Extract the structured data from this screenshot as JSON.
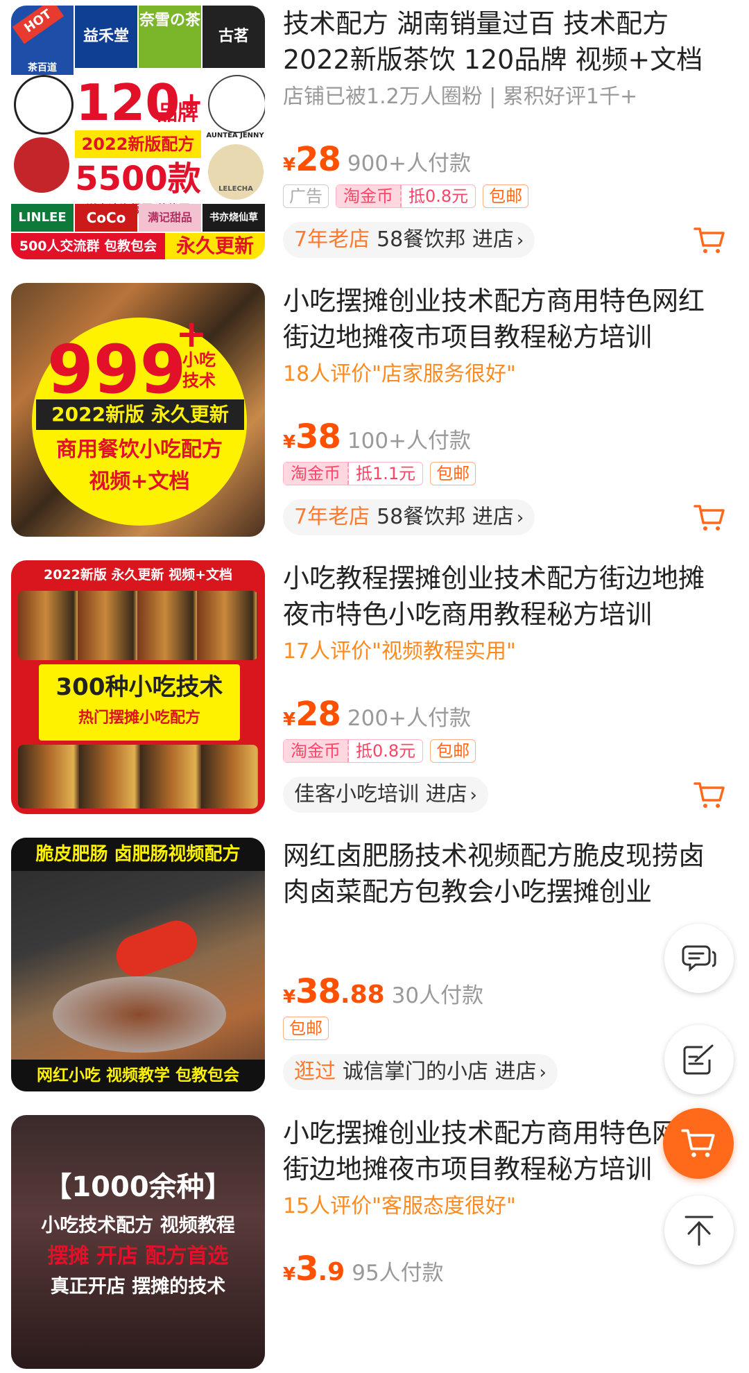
{
  "items": [
    {
      "title": "技术配方 湖南销量过百 技术配方 2022新版茶饮 120品牌 视频+文档 专",
      "subtitle": "店铺已被1.2万人圈粉 | 累积好评1千+",
      "subtitle_style": "gray",
      "currency": "¥",
      "price": "28",
      "price_decimal": "",
      "paid": "900+人付款",
      "ad_tag": "广告",
      "coin_label": "淘金币",
      "coin_value": "抵0.8元",
      "ship_tag": "包邮",
      "shop_badge": "7年老店",
      "shop_name": "58餐饮邦",
      "shop_enter": "进店",
      "thumb": {
        "hot": "HOT",
        "big": "120",
        "plus": "+",
        "brand_word": "品牌",
        "year_line": "2022新版配方",
        "count": "5500款",
        "bonus": "送高清海报图 装修图",
        "footer_left": "500人交流群 包教包会",
        "footer_right": "永久更新",
        "brands": [
          "益禾堂",
          "奈雪の茶",
          "古茗",
          "茶百道",
          "LINLEE",
          "CoCo",
          "满记甜品",
          "书亦烧仙草",
          "AUNTEA JENNY",
          "LELECHA"
        ]
      }
    },
    {
      "title": "小吃摆摊创业技术配方商用特色网红街边地摊夜市项目教程秘方培训",
      "subtitle": "18人评价\"店家服务很好\"",
      "subtitle_style": "orange",
      "currency": "¥",
      "price": "38",
      "price_decimal": "",
      "paid": "100+人付款",
      "coin_label": "淘金币",
      "coin_value": "抵1.1元",
      "ship_tag": "包邮",
      "shop_badge": "7年老店",
      "shop_name": "58餐饮邦",
      "shop_enter": "进店",
      "thumb": {
        "big": "999",
        "plus": "+",
        "side": "小吃技术",
        "line1": "2022新版 永久更新",
        "line2": "商用餐饮小吃配方",
        "line3": "视频+文档"
      }
    },
    {
      "title": "小吃教程摆摊创业技术配方街边地摊夜市特色小吃商用教程秘方培训",
      "subtitle": "17人评价\"视频教程实用\"",
      "subtitle_style": "orange",
      "currency": "¥",
      "price": "28",
      "price_decimal": "",
      "paid": "200+人付款",
      "coin_label": "淘金币",
      "coin_value": "抵0.8元",
      "ship_tag": "包邮",
      "shop_badge": "",
      "shop_name": "佳客小吃培训",
      "shop_enter": "进店",
      "thumb": {
        "top": "2022新版   永久更新   视频+文档",
        "big": "300种小吃技术",
        "small": "热门摆摊小吃配方"
      }
    },
    {
      "title": "网红卤肥肠技术视频配方脆皮现捞卤肉卤菜配方包教会小吃摆摊创业",
      "subtitle": "",
      "subtitle_style": "none",
      "currency": "¥",
      "price": "38",
      "price_decimal": ".88",
      "paid": "30人付款",
      "ship_tag": "包邮",
      "shop_badge": "逛过",
      "shop_name": "诚信掌门的小店",
      "shop_enter": "进店",
      "thumb": {
        "top": "脆皮肥肠 卤肥肠视频配方",
        "bottom": "网红小吃 视频教学 包教包会"
      }
    },
    {
      "title": "小吃摆摊创业技术配方商用特色网红街边地摊夜市项目教程秘方培训",
      "subtitle": "15人评价\"客服态度很好\"",
      "subtitle_style": "orange",
      "currency": "¥",
      "price": "3",
      "price_decimal": ".9",
      "paid": "95人付款",
      "thumb": {
        "big": "【1000余种】",
        "line1": "小吃技术配方 视频教程",
        "line2": "摆摊 开店 配方首选",
        "line3": "真正开店 摆摊的技术"
      }
    }
  ],
  "fab": {
    "chat_icon": "chat-bubble-icon",
    "note_icon": "edit-note-icon",
    "cart_icon": "shopping-cart-icon",
    "top_icon": "back-to-top-icon"
  },
  "colors": {
    "price": "#ff5000",
    "accent": "#ff6a1a",
    "subtitle_orange": "#ff8a1f"
  }
}
